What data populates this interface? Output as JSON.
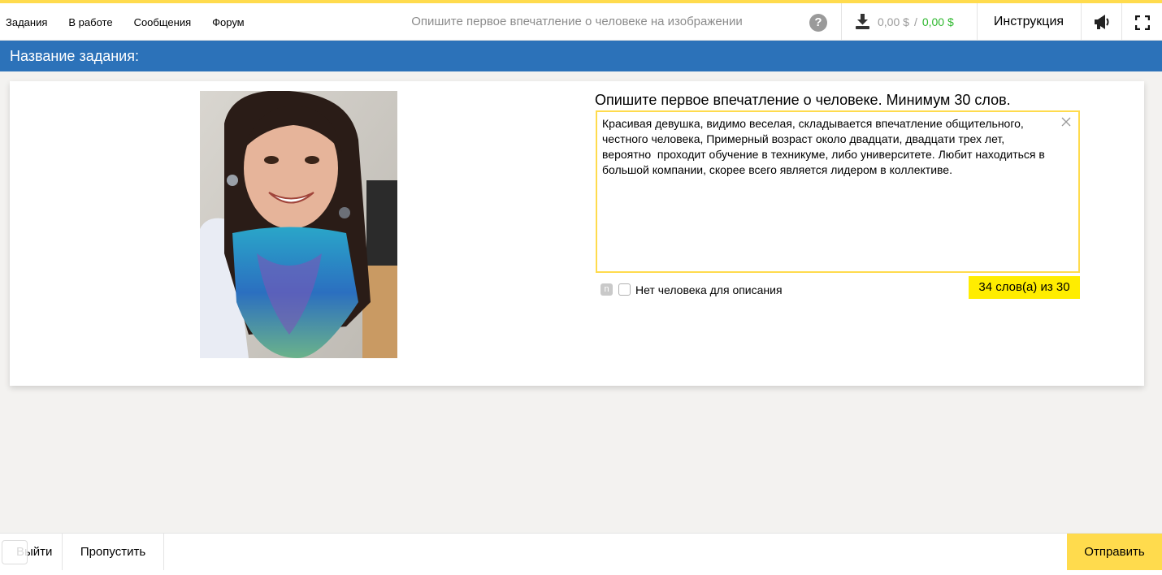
{
  "nav": {
    "items": [
      "Задания",
      "В работе",
      "Сообщения",
      "Форум"
    ]
  },
  "header": {
    "task_title": "Опишите первое впечатление о человеке на изображении",
    "help_label": "?",
    "balance_pending": "0,00 $",
    "balance_separator": "/",
    "balance_available": "0,00 $",
    "instruction_label": "Инструкция"
  },
  "taskbar": {
    "label": "Название задания:"
  },
  "task": {
    "prompt": "Опишите первое впечатление о человеке. Минимум 30 слов.",
    "answer": "Красивая девушка, видимо веселая, складывается впечатление общительного, честного человека, Примерный возраст около двадцати, двадцати трех лет, вероятно  проходит обучение в техникуме, либо университете. Любит находиться в большой компании, скорее всего является лидером в коллективе.",
    "hotkey": "n",
    "checkbox_label": "Нет человека для описания",
    "word_counter": "34 слов(а) из 30"
  },
  "footer": {
    "exit_label": "Выйти",
    "skip_label": "Пропустить",
    "submit_label": "Отправить"
  },
  "colors": {
    "accent_yellow": "#ffdb4d",
    "header_blue": "#2c72b9",
    "counter_yellow": "#ffed00",
    "balance_green": "#2fb82f"
  }
}
